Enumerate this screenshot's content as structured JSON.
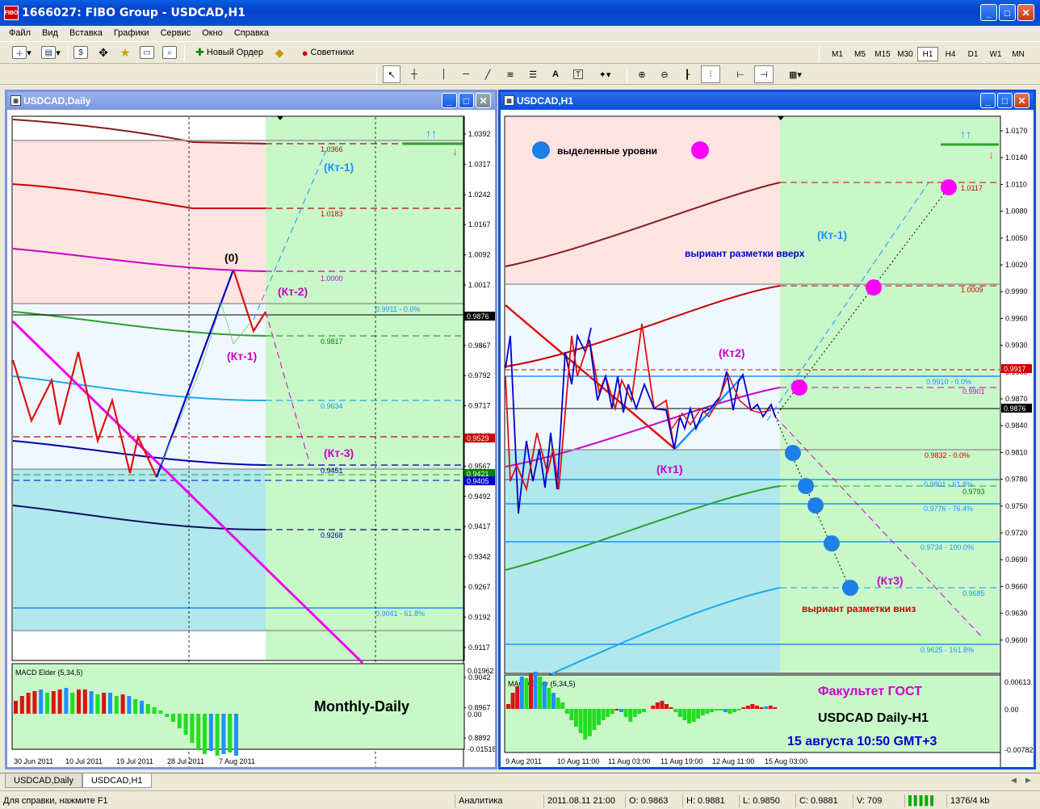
{
  "window": {
    "title": "1666027: FIBO Group - USDCAD,H1",
    "icon_label": "FIBO"
  },
  "menu": [
    "Файл",
    "Вид",
    "Вставка",
    "Графики",
    "Сервис",
    "Окно",
    "Справка"
  ],
  "toolbar": {
    "new_order": "Новый Ордер",
    "advisors": "Советники",
    "timeframes": [
      "M1",
      "M5",
      "M15",
      "M30",
      "H1",
      "H4",
      "D1",
      "W1",
      "MN"
    ],
    "active_timeframe": "H1"
  },
  "daily": {
    "title": "USDCAD,Daily",
    "price_axis": [
      "1.0392",
      "1.0317",
      "1.0242",
      "1.0167",
      "1.0092",
      "1.0017",
      "0.9942",
      "0.9867",
      "0.9792",
      "0.9717",
      "0.9642",
      "0.9567",
      "0.9492",
      "0.9417",
      "0.9342",
      "0.9267",
      "0.9192",
      "0.9117",
      "0.9042",
      "0.8967",
      "0.8892"
    ],
    "markers": [
      {
        "value": "0.9876",
        "color": "#000000"
      },
      {
        "value": "0.9529",
        "color": "#cc0000"
      },
      {
        "value": "0.9421",
        "color": "#008000"
      },
      {
        "value": "0.9405",
        "color": "#0000cc"
      }
    ],
    "level_labels": [
      {
        "text": "1.0366",
        "color": "#cc0000"
      },
      {
        "text": "1.0183",
        "color": "#cc0000"
      },
      {
        "text": "1.0000",
        "color": "#cc00cc"
      },
      {
        "text": "0.9911 - 0.0%",
        "color": "#1e90ff"
      },
      {
        "text": "0.9817",
        "color": "#008000"
      },
      {
        "text": "0.9634",
        "color": "#1e90ff"
      },
      {
        "text": "0.9451",
        "color": "#00008b"
      },
      {
        "text": "0.9268",
        "color": "#00008b"
      },
      {
        "text": "0.9041 - 61.8%",
        "color": "#1e90ff"
      }
    ],
    "annotations": [
      {
        "text": "(0)",
        "color": "#000000"
      },
      {
        "text": "(Кт-1)",
        "color": "#1e90ff"
      },
      {
        "text": "(Кт-2)",
        "color": "#cc00cc"
      },
      {
        "text": "(Кт-1)",
        "color": "#cc00cc"
      },
      {
        "text": "(Кт-3)",
        "color": "#cc00cc"
      }
    ],
    "indicator": {
      "name": "MACD Elder (5,34,5)",
      "axis": [
        "0.01962",
        "0.00",
        "-0.01518"
      ]
    },
    "panel_label": "Monthly-Daily",
    "dates": [
      "30 Jun 2011",
      "10 Jul 2011",
      "19 Jul 2011",
      "28 Jul 2011",
      "7 Aug 2011"
    ]
  },
  "h1": {
    "title": "USDCAD,H1",
    "price_axis": [
      "1.0170",
      "1.0140",
      "1.0110",
      "1.0080",
      "1.0050",
      "1.0020",
      "0.9990",
      "0.9960",
      "0.9930",
      "0.9900",
      "0.9870",
      "0.9840",
      "0.9810",
      "0.9780",
      "0.9750",
      "0.9720",
      "0.9690",
      "0.9660",
      "0.9630",
      "0.9600"
    ],
    "markers": [
      {
        "value": "0.9917",
        "color": "#cc0000"
      },
      {
        "value": "0.9876",
        "color": "#000000"
      }
    ],
    "legend": "выделенные уровни",
    "level_labels": [
      {
        "text": "1.0117",
        "color": "#cc0000"
      },
      {
        "text": "1.0009",
        "color": "#cc0000"
      },
      {
        "text": "0.9910 - 0.0%",
        "color": "#1e90ff"
      },
      {
        "text": "0.9901",
        "color": "#cc00cc"
      },
      {
        "text": "0.9832 - 0.0%",
        "color": "#cc0000"
      },
      {
        "text": "0.9801 - 61.8%",
        "color": "#1e90ff"
      },
      {
        "text": "0.9793",
        "color": "#008000"
      },
      {
        "text": "0.9776 - 76.4%",
        "color": "#1e90ff"
      },
      {
        "text": "0.9734 - 100.0%",
        "color": "#1e90ff"
      },
      {
        "text": "0.9685",
        "color": "#1e90ff"
      },
      {
        "text": "0.9625 - 161.8%",
        "color": "#1e90ff"
      }
    ],
    "annotations": [
      {
        "text": "(Кт-1)",
        "color": "#1e90ff"
      },
      {
        "text": "выриант разметки вверх",
        "color": "#0000cc"
      },
      {
        "text": "(Кт2)",
        "color": "#cc00cc"
      },
      {
        "text": "(Кт1)",
        "color": "#cc00cc"
      },
      {
        "text": "(Кт3)",
        "color": "#cc00cc"
      },
      {
        "text": "выриант разметки вниз",
        "color": "#cc0000"
      }
    ],
    "indicator": {
      "name": "MACD Elder (5,34,5)",
      "axis": [
        "0.00613",
        "0.00",
        "-0.00782"
      ]
    },
    "info_lines": [
      {
        "text": "Факультет ГОСТ",
        "color": "#cc00cc"
      },
      {
        "text": "USDCAD Daily-H1",
        "color": "#000000"
      },
      {
        "text": "15 августа 10:50 GMT+3",
        "color": "#0000cc"
      }
    ],
    "dates": [
      "9 Aug 2011",
      "10 Aug 11:00",
      "11 Aug 03:00",
      "11 Aug 19:00",
      "12 Aug 11:00",
      "15 Aug 03:00"
    ]
  },
  "tabs": [
    "USDCAD,Daily",
    "USDCAD,H1"
  ],
  "active_tab": "USDCAD,H1",
  "status": {
    "help": "Для справки, нажмите F1",
    "profile": "Аналитика",
    "datetime": "2011.08.11 21:00",
    "open": "O: 0.9863",
    "high": "H: 0.9881",
    "low": "L: 0.9850",
    "close": "C: 0.9881",
    "volume": "V: 709",
    "traffic": "1376/4 kb"
  }
}
